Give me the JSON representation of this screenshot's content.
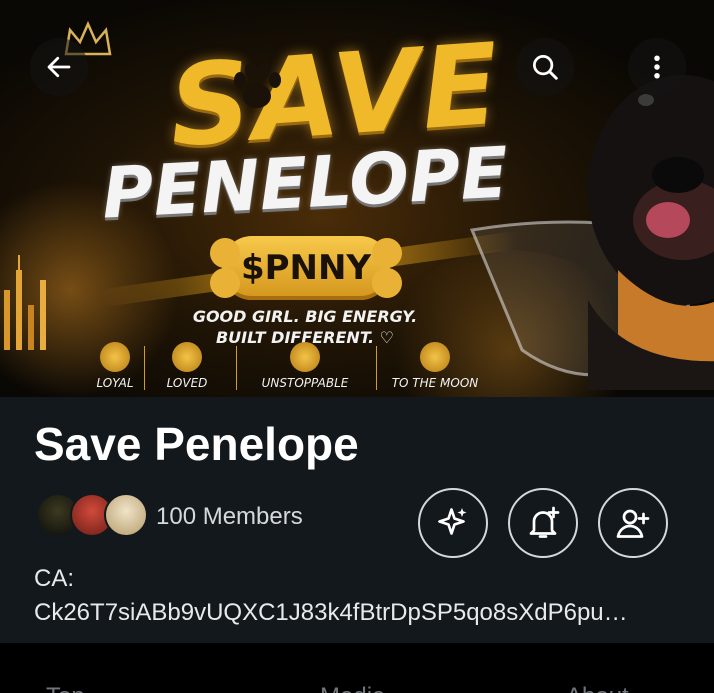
{
  "banner": {
    "title_line1": "SAVE",
    "title_line2": "PENELOPE",
    "ticker": "$PNNY",
    "tagline_line1": "GOOD GIRL.  BIG ENERGY.",
    "tagline_line2": "BUILT DIFFERENT. ♡",
    "features": [
      {
        "label": "LOYAL",
        "icon": "paw-icon"
      },
      {
        "label": "LOVED",
        "icon": "heart-icon"
      },
      {
        "label": "UNSTOPPABLE",
        "icon": "bone-icon"
      },
      {
        "label": "TO THE MOON",
        "icon": "rocket-icon"
      }
    ],
    "accent_color": "#f0b92a"
  },
  "header": {
    "back_icon": "arrow-left-icon",
    "search_icon": "search-icon",
    "more_icon": "more-vertical-icon"
  },
  "community": {
    "name": "Save Penelope",
    "members_text": "100 Members",
    "ca_label": "CA:",
    "ca_value": "Ck26T7siABb9vUQXC1J83k4fBtrDpSP5qo8sXdP6pu…",
    "actions": [
      {
        "icon": "sparkle-icon"
      },
      {
        "icon": "bell-add-icon"
      },
      {
        "icon": "person-add-icon"
      }
    ]
  },
  "tabs": [
    {
      "label": "Top"
    },
    {
      "label": "Media"
    },
    {
      "label": "About"
    }
  ],
  "colors": {
    "background": "#000000",
    "panel": "#13181c",
    "text": "#e7e9ea",
    "muted": "#71767b"
  }
}
